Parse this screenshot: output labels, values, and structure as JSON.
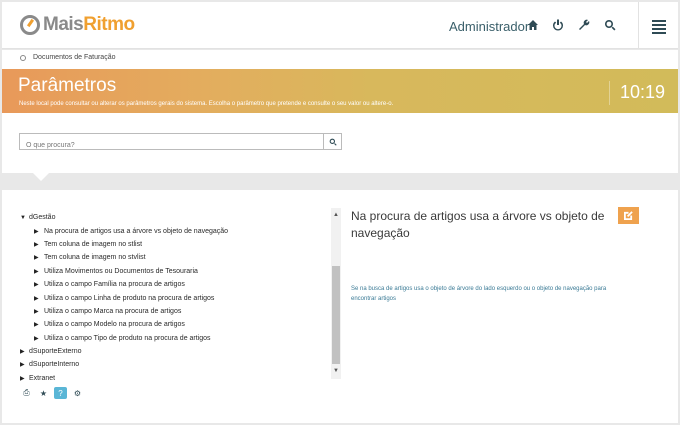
{
  "brand": {
    "part1": "Mais",
    "part2": "Ritmo"
  },
  "header": {
    "user": "Administrador",
    "icons": [
      "home-icon",
      "power-icon",
      "wrench-icon",
      "search-icon",
      "menu-icon"
    ]
  },
  "breadcrumb": {
    "label": "Documentos de Faturação"
  },
  "banner": {
    "title": "Parâmetros",
    "subtitle": "Neste local pode consultar ou alterar os parâmetros gerais do sistema. Escolha o parâmetro que pretende e consulte o seu valor ou altere-o.",
    "time": "10:19"
  },
  "search": {
    "placeholder": "O que procura?"
  },
  "tree": {
    "groups": [
      {
        "label": "dGestão",
        "children": [
          "Na procura de artigos usa a árvore vs objeto de navegação",
          "Tem coluna de imagem no stlist",
          "Tem coluna de imagem no stvlist",
          "Utiliza Movimentos ou Documentos de Tesouraria",
          "Utiliza o campo Família na procura de artigos",
          "Utiliza o campo Linha de produto na procura de artigos",
          "Utiliza o campo Marca na procura de artigos",
          "Utiliza o campo Modelo na procura de artigos",
          "Utiliza o campo Tipo de produto na procura de artigos"
        ]
      },
      {
        "label": "dSuporteExterno"
      },
      {
        "label": "dSuporteInterno"
      },
      {
        "label": "Extranet"
      }
    ]
  },
  "toolbar": {
    "icons": [
      "print-icon",
      "star-icon",
      "help-icon",
      "gear-icon"
    ]
  },
  "detail": {
    "title": "Na procura de artigos usa a árvore vs objeto de navegação",
    "description": "Se na busca de artigos usa o objeto de árvore do lado esquerdo ou o objeto de navegação para encontrar artigos"
  },
  "colors": {
    "accent": "#efa24e",
    "banner_start": "#e8995a",
    "banner_end": "#d2bb5a",
    "link": "#3a7a95"
  }
}
